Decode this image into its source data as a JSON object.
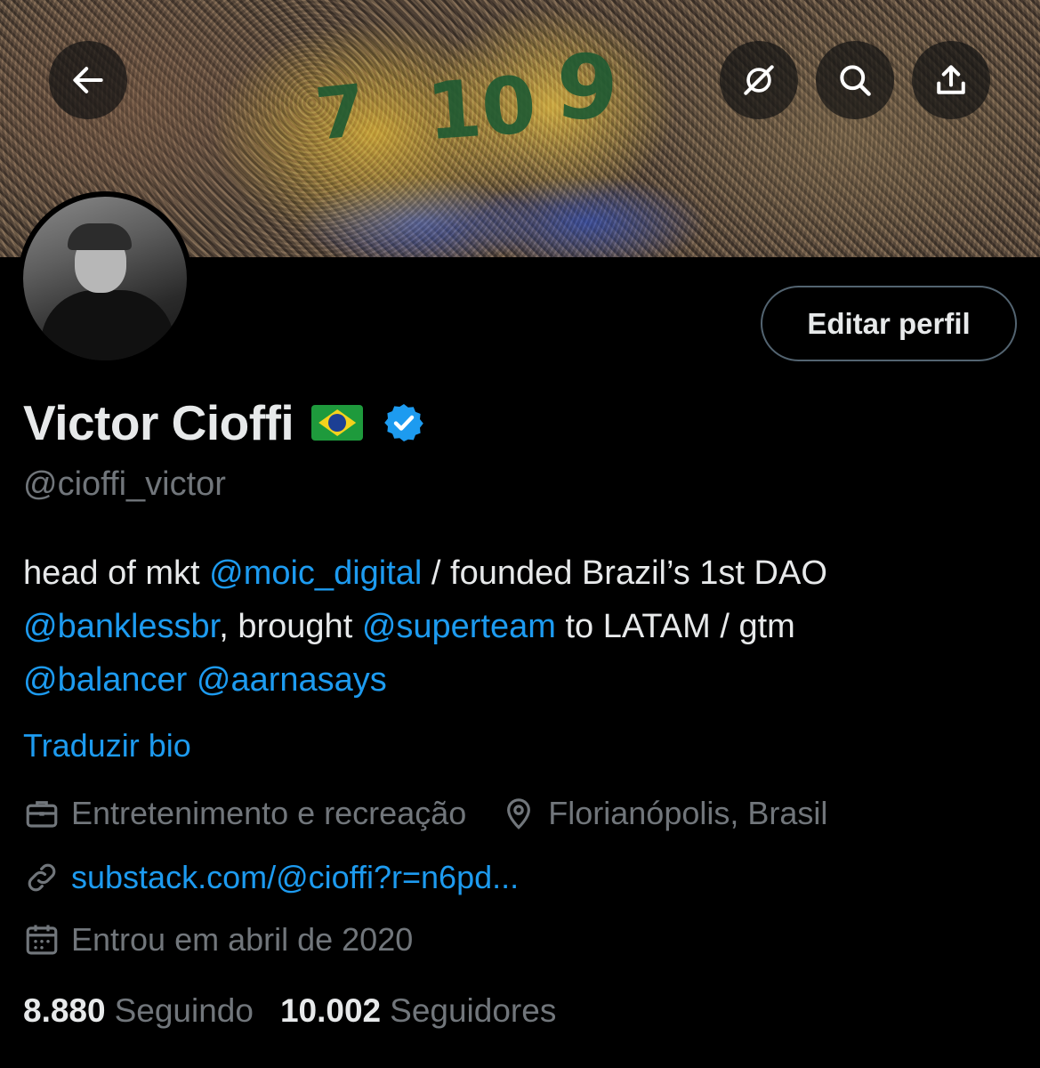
{
  "banner": {
    "jersey_numbers": [
      "10",
      "9",
      "7"
    ]
  },
  "top_buttons": {
    "back_icon": "arrow-left-icon",
    "grok_icon": "grok-icon",
    "search_icon": "search-icon",
    "share_icon": "share-icon"
  },
  "profile": {
    "edit_label": "Editar perfil",
    "display_name": "Victor Cioffi",
    "flag": "brazil-flag",
    "handle": "@cioffi_victor",
    "bio": {
      "seg1": "head of mkt ",
      "mention1": "@moic_digital",
      "seg2": " / founded Brazil’s 1st DAO ",
      "mention2": "@banklessbr",
      "seg3": ", brought ",
      "mention3": "@superteam",
      "seg4": " to LATAM / gtm ",
      "mention4": "@balancer",
      "seg5": " ",
      "mention5": "@aarnasays"
    },
    "translate_label": "Traduzir bio",
    "category": "Entretenimento e recreação",
    "location": "Florianópolis, Brasil",
    "website": "substack.com/@cioffi?r=n6pd...",
    "joined": "Entrou em abril de 2020",
    "following_count": "8.880",
    "following_label": "Seguindo",
    "followers_count": "10.002",
    "followers_label": "Seguidores"
  },
  "colors": {
    "background": "#000000",
    "text": "#e7e9ea",
    "muted": "#71767b",
    "accent": "#1d9bf0"
  }
}
